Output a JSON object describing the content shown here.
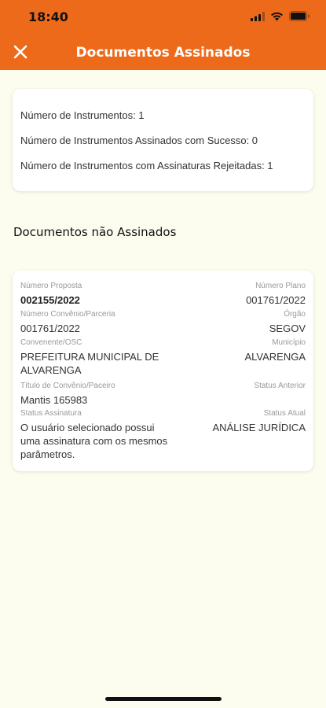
{
  "status_bar": {
    "time": "18:40"
  },
  "header": {
    "title": "Documentos Assinados"
  },
  "summary": {
    "line1": "Número de Instrumentos: 1",
    "line2": "Número de Instrumentos Assinados com Sucesso: 0",
    "line3": "Número de Instrumentos com Assinaturas Rejeitadas: 1"
  },
  "section": {
    "title": "Documentos não Assinados"
  },
  "document": {
    "numero_proposta_label": "Número Proposta",
    "numero_proposta": "002155/2022",
    "numero_plano_label": "Número Plano",
    "numero_plano": "001761/2022",
    "numero_convenio_label": "Número Convênio/Parceria",
    "numero_convenio": "001761/2022",
    "orgao_label": "Órgão",
    "orgao": "SEGOV",
    "convenente_label": "Convenente/OSC",
    "convenente_line1": "PREFEITURA MUNICIPAL DE",
    "convenente_line2": "ALVARENGA",
    "municipio_label": "Município",
    "municipio": "ALVARENGA",
    "titulo_label": "Título de Convênio/Paceiro",
    "titulo": "Mantis 165983",
    "status_anterior_label": "Status Anterior",
    "status_anterior": "",
    "status_assinatura_label": "Status Assinatura",
    "status_assinatura_line1": "O usuário selecionado possui",
    "status_assinatura_line2": "uma assinatura com os mesmos",
    "status_assinatura_line3": "parâmetros.",
    "status_atual_label": "Status Atual",
    "status_atual": "ANÁLISE JURÍDICA"
  },
  "colors": {
    "accent": "#EE6A1B",
    "background": "#FDFDEF"
  }
}
